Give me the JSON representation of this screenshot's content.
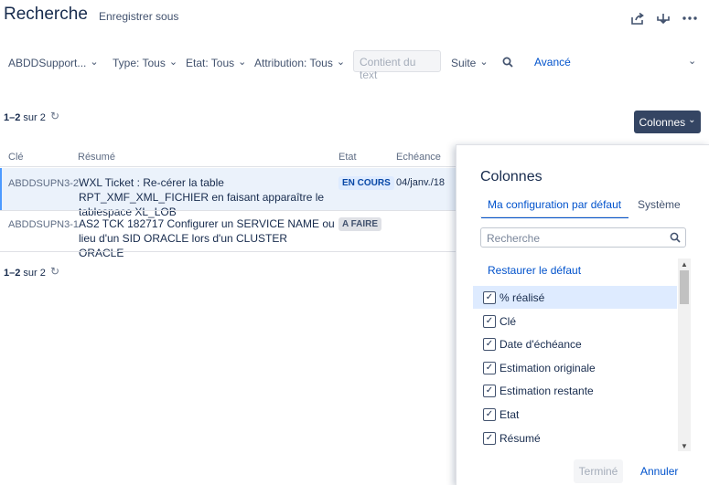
{
  "header": {
    "title": "Recherche",
    "save_as": "Enregistrer sous",
    "icons": [
      "share-icon",
      "export-icon",
      "more-icon"
    ]
  },
  "filters": {
    "project": "ABDDSupport...",
    "type": "Type: Tous",
    "status": "Etat: Tous",
    "assignee": "Attribution: Tous",
    "text_placeholder": "Contient du text",
    "more": "Suite",
    "advanced": "Avancé"
  },
  "results": {
    "count_prefix": "1–2",
    "count_suffix": "sur 2",
    "columns_button": "Colonnes"
  },
  "table": {
    "headers": {
      "key": "Clé",
      "summary": "Résumé",
      "status": "Etat",
      "due": "Echéance"
    },
    "rows": [
      {
        "key": "ABDDSUPN3-2",
        "summary": "WXL Ticket : Re-cérer la table RPT_XMF_XML_FICHIER en faisant apparaître le tablespace XL_LOB",
        "status": "EN COURS",
        "due": "04/janv./18"
      },
      {
        "key": "ABDDSUPN3-1",
        "summary": "AS2 TCK 182717 Configurer un SERVICE NAME ou lieu d'un SID ORACLE lors d'un CLUSTER ORACLE",
        "status": "A FAIRE",
        "due": ""
      }
    ]
  },
  "columns_panel": {
    "title": "Colonnes",
    "tab_default": "Ma configuration par défaut",
    "tab_system": "Système",
    "search_placeholder": "Recherche",
    "restore": "Restaurer le défaut",
    "options": [
      {
        "label": "% réalisé",
        "checked": true
      },
      {
        "label": "Clé",
        "checked": true
      },
      {
        "label": "Date d'échéance",
        "checked": true
      },
      {
        "label": "Estimation originale",
        "checked": true
      },
      {
        "label": "Estimation restante",
        "checked": true
      },
      {
        "label": "Etat",
        "checked": true
      },
      {
        "label": "Résumé",
        "checked": true
      }
    ],
    "done": "Terminé",
    "cancel": "Annuler"
  },
  "colors": {
    "accent": "#0052cc",
    "columns_button_bg": "#344563",
    "selected_row": "#ebf2fb"
  }
}
